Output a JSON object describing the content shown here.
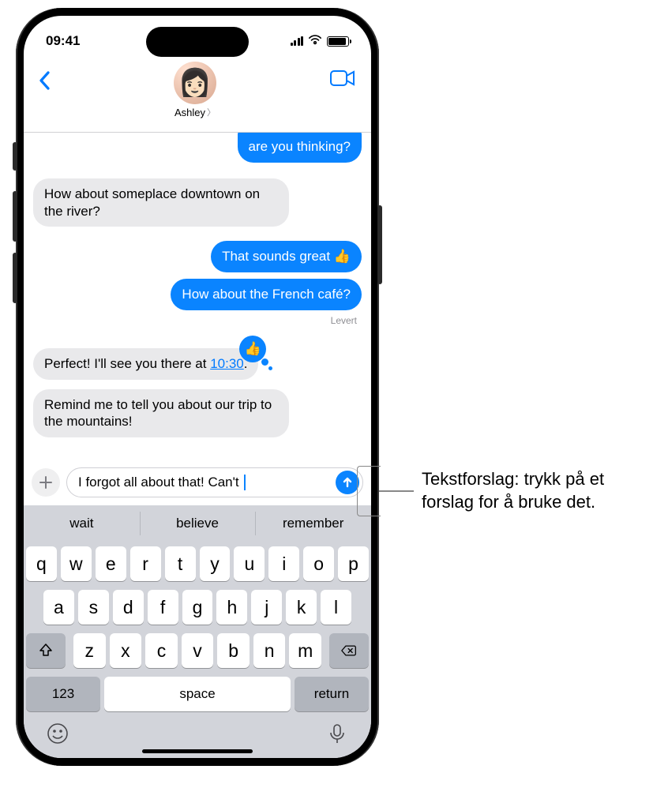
{
  "status": {
    "time": "09:41"
  },
  "header": {
    "contact_name": "Ashley"
  },
  "messages": {
    "m0": "are you thinking?",
    "m1": "How about someplace downtown on the river?",
    "m2": "That sounds great 👍",
    "m3": "How about the French café?",
    "delivered": "Levert",
    "m4_pre": "Perfect! I'll see you there at ",
    "m4_time": "10:30",
    "m4_post": ".",
    "m5": "Remind me to tell you about our trip to the mountains!"
  },
  "compose": {
    "text": "I forgot all about that! Can't "
  },
  "predictive": {
    "p1": "wait",
    "p2": "believe",
    "p3": "remember"
  },
  "keyboard": {
    "row1": [
      "q",
      "w",
      "e",
      "r",
      "t",
      "y",
      "u",
      "i",
      "o",
      "p"
    ],
    "row2": [
      "a",
      "s",
      "d",
      "f",
      "g",
      "h",
      "j",
      "k",
      "l"
    ],
    "row3": [
      "z",
      "x",
      "c",
      "v",
      "b",
      "n",
      "m"
    ],
    "numKey": "123",
    "space": "space",
    "return": "return"
  },
  "callout": {
    "text": "Tekstforslag: trykk på et forslag for å bruke det."
  }
}
